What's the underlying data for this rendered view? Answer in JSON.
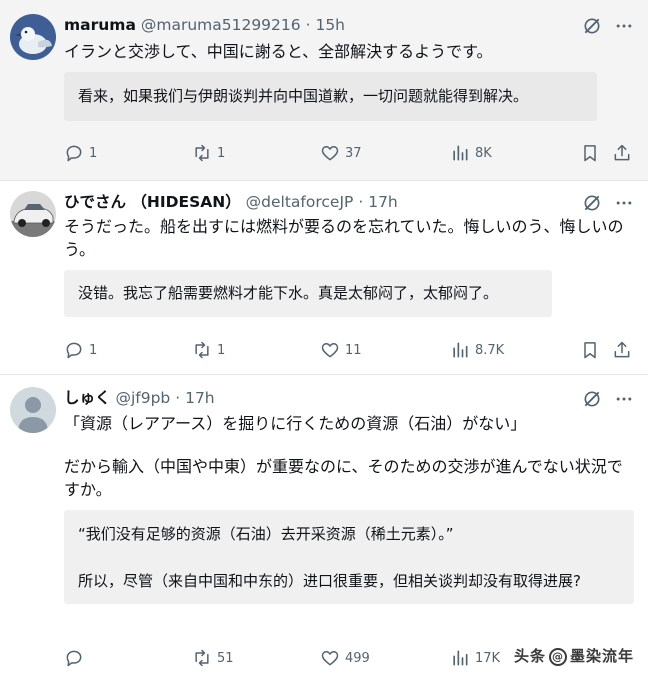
{
  "tweets": [
    {
      "name": "maruma",
      "handle": "@maruma51299216",
      "dot": "·",
      "time": "15h",
      "text": [
        "イランと交渉して、中国に謝ると、全部解決するようです。"
      ],
      "translation": [
        "看来，如果我们与伊朗谈判并向中国道歉，一切问题就能得到解决。"
      ],
      "replies": "1",
      "reposts": "1",
      "likes": "37",
      "views": "8K"
    },
    {
      "name": "ひでさん （HIDESAN）",
      "handle": "@deltaforceJP",
      "dot": "·",
      "time": "17h",
      "text": [
        "そうだった。船を出すには燃料が要るのを忘れていた。悔しいのう、悔しいのう。"
      ],
      "translation": [
        "没错。我忘了船需要燃料才能下水。真是太郁闷了，太郁闷了。"
      ],
      "replies": "1",
      "reposts": "1",
      "likes": "11",
      "views": "8.7K"
    },
    {
      "name": "しゅく",
      "handle": "@jf9pb",
      "dot": "·",
      "time": "17h",
      "text": [
        "「資源（レアアース）を掘りに行くための資源（石油）がない」",
        "だから輸入（中国や中東）が重要なのに、そのための交渉が進んでない状況ですか。"
      ],
      "translation": [
        "“我们没有足够的资源（石油）去开采资源（稀土元素）。”",
        "所以，尽管（来自中国和中东的）进口很重要，但相关谈判却没有取得进展?"
      ],
      "replies": "",
      "reposts": "51",
      "likes": "499",
      "views": "17K"
    }
  ],
  "watermark": {
    "prefix": "头条",
    "author": "墨染流年",
    "symbol": "@"
  },
  "icons": {
    "grok": "grok-icon",
    "more": "more-icon",
    "reply": "reply-icon",
    "repost": "repost-icon",
    "like": "heart-icon",
    "views": "views-icon",
    "bookmark": "bookmark-icon",
    "share": "share-icon"
  },
  "colors": {
    "text": "#0f1419",
    "secondary": "#536471",
    "translation_bg": "#f0f0f0",
    "highlight_bg": "#f4f4f4"
  }
}
